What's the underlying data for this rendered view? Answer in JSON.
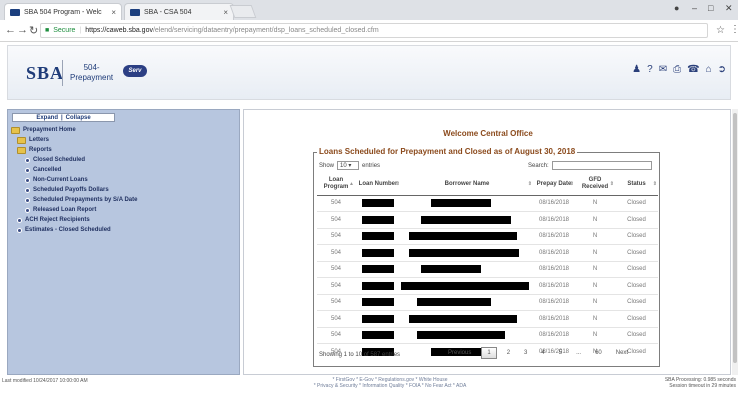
{
  "browser": {
    "tabs": [
      {
        "label": "SBA 504 Program - Welc",
        "active": true
      },
      {
        "label": "SBA - CSA 504",
        "active": false
      }
    ],
    "secure_label": "Secure",
    "url_host": "https://caweb.sba.gov",
    "url_path": "/elend/servicing/dataentry/prepayment/dsp_loans_scheduled_closed.cfm"
  },
  "header": {
    "logo": "SBA",
    "app_line1": "504-",
    "app_line2": "Prepayment",
    "badge": "Serv",
    "icons": [
      "user-icon",
      "help-icon",
      "chat-icon",
      "print-icon",
      "phone-icon",
      "home-icon",
      "logout-icon"
    ]
  },
  "sidebar": {
    "expand": "Expand",
    "separator": "|",
    "collapse": "Collapse",
    "root": "Prepayment Home",
    "letters": "Letters",
    "reports": "Reports",
    "report_items": [
      "Closed Scheduled",
      "Cancelled",
      "Non-Current Loans",
      "Scheduled Payoffs Dollars",
      "Scheduled Prepayments by S/A Date",
      "Released Loan Report"
    ],
    "other_items": [
      "ACH Reject Recipients",
      "Estimates - Closed Scheduled"
    ]
  },
  "main": {
    "welcome": "Welcome Central Office",
    "legend": "Loans Scheduled for Prepayment and Closed as of August 30, 2018",
    "show_label": "Show",
    "show_value": "10",
    "entries_label": "entries",
    "search_label": "Search:",
    "columns": [
      "Loan Program",
      "Loan Number",
      "Borrower Name",
      "Prepay Date",
      "GFD Received",
      "Status"
    ],
    "rows": [
      {
        "program": "504",
        "prepay": "08/16/2018",
        "gfd": "N",
        "status": "Closed"
      },
      {
        "program": "504",
        "prepay": "08/16/2018",
        "gfd": "N",
        "status": "Closed"
      },
      {
        "program": "504",
        "prepay": "08/16/2018",
        "gfd": "N",
        "status": "Closed"
      },
      {
        "program": "504",
        "prepay": "08/16/2018",
        "gfd": "N",
        "status": "Closed"
      },
      {
        "program": "504",
        "prepay": "08/16/2018",
        "gfd": "N",
        "status": "Closed"
      },
      {
        "program": "504",
        "prepay": "08/16/2018",
        "gfd": "N",
        "status": "Closed"
      },
      {
        "program": "504",
        "prepay": "08/16/2018",
        "gfd": "N",
        "status": "Closed"
      },
      {
        "program": "504",
        "prepay": "08/16/2018",
        "gfd": "N",
        "status": "Closed"
      },
      {
        "program": "504",
        "prepay": "08/16/2018",
        "gfd": "N",
        "status": "Closed"
      },
      {
        "program": "504",
        "prepay": "08/16/2018",
        "gfd": "N",
        "status": "Closed"
      }
    ],
    "info": "Showing 1 to 10 of 587 entries",
    "pager": {
      "previous": "Previous",
      "pages": [
        "1",
        "2",
        "3",
        "4",
        "5",
        "...",
        "60"
      ],
      "current": "1",
      "next": "Next"
    }
  },
  "footer": {
    "last_modified": "Last modified 10/24/2017 10:00:00 AM",
    "links_line1": "* FirstGov * E-Gov * Regulations.gov * White House",
    "links_line2": "* Privacy & Security * Information Quality * FOIA * No Fear Act * ADA",
    "proc_line1": "SBA Processing: 0.985 seconds",
    "proc_line2": "Session timeout in 29 minutes"
  }
}
